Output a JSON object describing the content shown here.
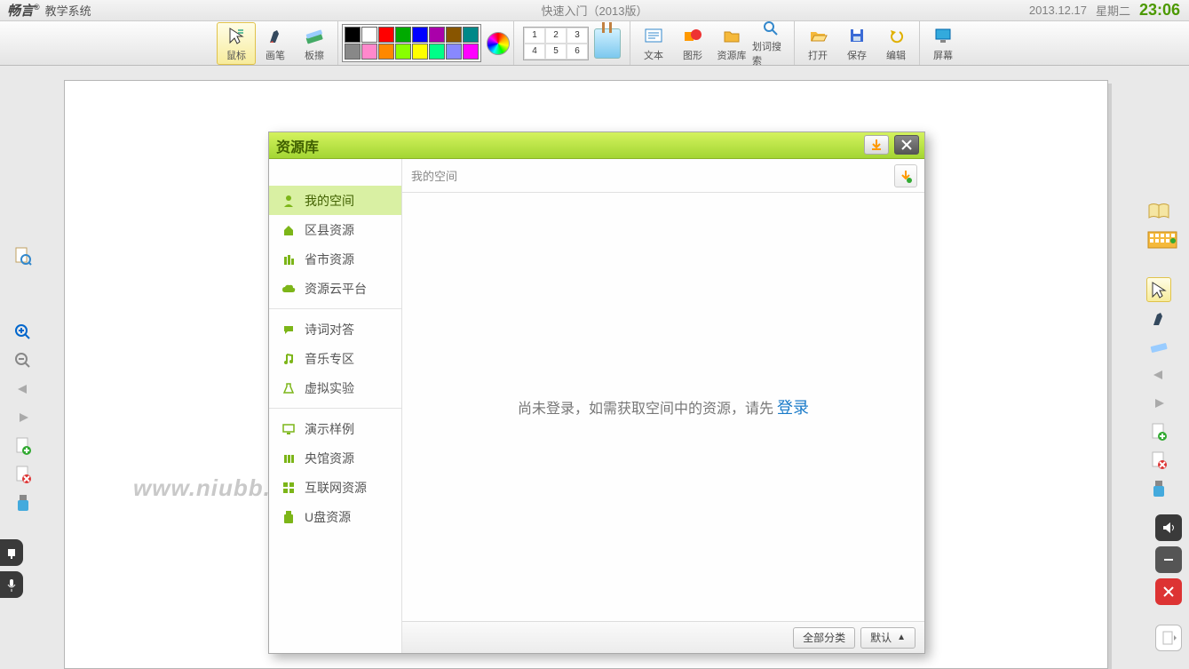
{
  "titlebar": {
    "app_brand": "畅言",
    "app_reg": "®",
    "app_system": "教学系统",
    "center_title": "快速入门（2013版）",
    "date": "2013.12.17",
    "weekday": "星期二",
    "time": "23:06"
  },
  "toolbar": {
    "tools": {
      "mouse": "鼠标",
      "pen": "画笔",
      "eraser": "板擦",
      "text": "文本",
      "shape": "图形",
      "resources": "资源库",
      "dict": "划词搜索",
      "open": "打开",
      "save": "保存",
      "edit": "编辑",
      "screen": "屏幕"
    },
    "thickness": {
      "t1": "1",
      "t2": "2",
      "t3": "3",
      "t4": "4",
      "t5": "5",
      "t6": "6"
    },
    "palette_colors": [
      "#000000",
      "#ffffff",
      "#ff0000",
      "#00a000",
      "#0000ff",
      "#a000a0",
      "#805000",
      "#008080",
      "#808080",
      "#ff80c0",
      "#ff8000",
      "#80ff00",
      "#ffff00",
      "#00ff80",
      "#8080ff",
      "#ff00ff"
    ]
  },
  "canvas": {
    "watermark": "www.niubb.net"
  },
  "modal": {
    "title": "资源库",
    "breadcrumb": "我的空间",
    "nav": {
      "my_space": "我的空间",
      "district": "区县资源",
      "province": "省市资源",
      "cloud": "资源云平台",
      "poetry": "诗词对答",
      "music": "音乐专区",
      "virtual": "虚拟实验",
      "demo": "演示样例",
      "national": "央馆资源",
      "internet": "互联网资源",
      "usb": "U盘资源"
    },
    "content": {
      "prompt_prefix": "尚未登录，如需获取空间中的资源，请先 ",
      "login": "登录"
    },
    "footer": {
      "all_categories": "全部分类",
      "default": "默认"
    }
  },
  "side_icons": {
    "left": {
      "doc_search": "doc-search",
      "zoom_in": "zoom-in",
      "zoom_out": "zoom-out",
      "prev": "prev",
      "next": "next",
      "page_add": "page-add",
      "page_del": "page-del",
      "usb": "usb"
    },
    "right1": {
      "book": "book",
      "keyboard": "keyboard",
      "pointer": "pointer",
      "pen": "pen",
      "eraser": "eraser",
      "prev": "prev",
      "next": "next",
      "page_add": "page-add",
      "page_del": "page-del",
      "usb": "usb"
    },
    "right2": {
      "audio": "audio",
      "minimize": "minimize",
      "close": "close",
      "page": "page"
    }
  },
  "leftbottom": {
    "hand": "hand",
    "mic": "mic"
  }
}
